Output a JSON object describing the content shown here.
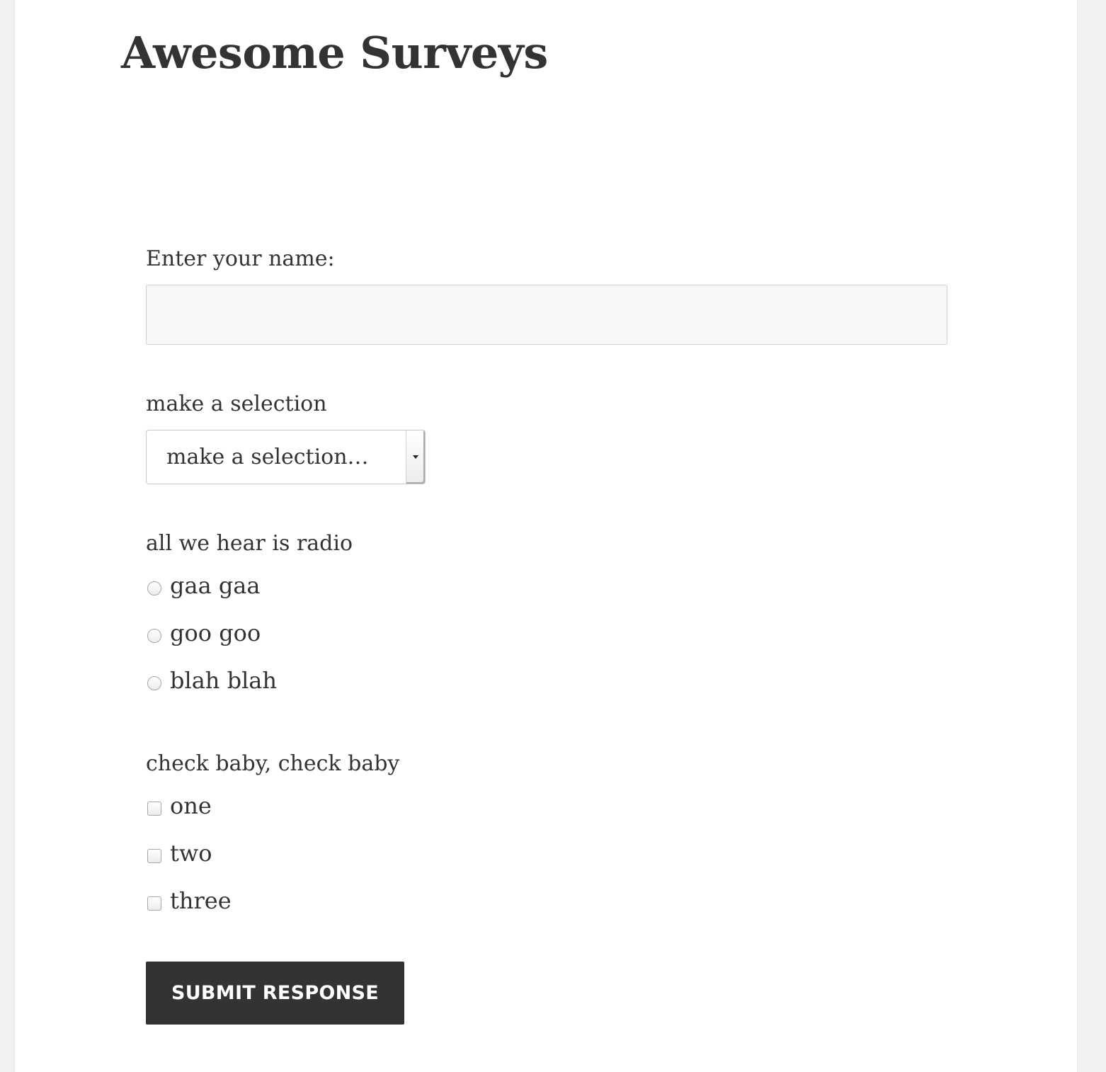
{
  "site": {
    "title": "Awesome Surveys"
  },
  "form": {
    "name_label": "Enter your name:",
    "name_value": "",
    "name_placeholder": "",
    "select_label": "make a selection",
    "select_value": "make a selection…",
    "radio_label": "all we hear is radio",
    "radio_options": [
      "gaa gaa",
      "goo goo",
      "blah blah"
    ],
    "check_label": "check baby, check baby",
    "check_options": [
      "one",
      "two",
      "three"
    ],
    "submit_label": "SUBMIT RESPONSE"
  },
  "colors": {
    "background": "#f1f1f1",
    "page": "#ffffff",
    "text": "#333333",
    "button": "#333333",
    "button_text": "#ffffff",
    "input_bg": "#f7f7f7"
  }
}
